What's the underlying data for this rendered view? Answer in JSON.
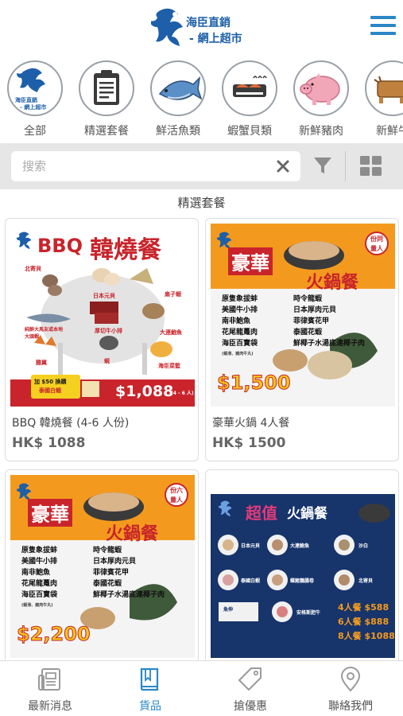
{
  "header": {
    "logo_line1": "海臣直銷",
    "logo_line2": "- 網上超市",
    "logo_mini1": "海臣直銷",
    "logo_mini2": "- 網上超市"
  },
  "categories": [
    {
      "label": "全部",
      "icon": "logo-icon"
    },
    {
      "label": "精選套餐",
      "icon": "clipboard-icon"
    },
    {
      "label": "鮮活魚類",
      "icon": "fish-icon"
    },
    {
      "label": "蝦蟹貝類",
      "icon": "shellfish-icon"
    },
    {
      "label": "新鮮豬肉",
      "icon": "pig-icon"
    },
    {
      "label": "新鮮牛",
      "icon": "cow-icon"
    }
  ],
  "search": {
    "placeholder": "搜索",
    "value": ""
  },
  "section_title": "精選套餐",
  "products": [
    {
      "name": "BBQ 韓燒餐 (4-6 人份)",
      "price": "HK$ 1088",
      "poster": {
        "title_en": "BBQ",
        "title_zh": "韓燒餐",
        "items": [
          "北寄貝",
          "日本元貝",
          "扇子蝦",
          "純鮮大馬友或本地大頭蝦",
          "厚切牛小排",
          "大連鮑魚",
          "雞翼",
          "蜆",
          "海臣菜籃"
        ],
        "promo_1": "加 $50 換購",
        "promo_2": "泰國白蝦",
        "price": "$1,088",
        "servings": "(4 - 6 人)"
      }
    },
    {
      "name": "豪華火鍋 4人餐",
      "price": "HK$ 1500",
      "poster": {
        "title_1": "豪華",
        "title_2": "火鍋餐",
        "badge_1": "份同",
        "badge_2": "量人",
        "items_left": [
          "原隻象拔蚌",
          "美國牛小排",
          "南非鮑魚",
          "花尾龍躉肉",
          "海臣百寶袋"
        ],
        "items_right": [
          "時令龍蝦",
          "日本厚肉元貝",
          "菲律賓花甲",
          "泰國花蝦",
          "鮮椰子水湯底連椰子肉"
        ],
        "note": "(蝦滑、豬肉牛丸)",
        "price": "$1,500"
      }
    },
    {
      "name": "豪華火鍋 6人餐",
      "price": "HK$ 2200",
      "poster": {
        "title_1": "豪華",
        "title_2": "火鍋餐",
        "badge_1": "份六",
        "badge_2": "量人",
        "items_left": [
          "原隻象拔蚌",
          "美國牛小排",
          "南非鮑魚",
          "花尾龍躉肉",
          "海臣百寶袋"
        ],
        "items_right": [
          "時令龍蝦",
          "日本厚肉元貝",
          "菲律賓花甲",
          "泰國花蝦",
          "鮮椰子水湯底連椰子肉"
        ],
        "note": "(蝦滑、豬肉牛丸)",
        "price": "$2,200"
      }
    },
    {
      "name": "超值火鍋餐",
      "price": "",
      "poster": {
        "title_1": "超值",
        "title_2": "火鍋餐",
        "items": [
          "日本元貝",
          "大連鮑魚",
          "沙白",
          "泰國白蝦",
          "蝶豬鵝腸卷",
          "北寄貝",
          "魚伸",
          "安格斯肥牛"
        ],
        "offer_1": "4人餐 $588",
        "offer_2": "6人餐 $888",
        "offer_3": "8人餐 $1088"
      }
    }
  ],
  "bottom_nav": [
    {
      "label": "最新消息",
      "icon": "news-icon"
    },
    {
      "label": "貨品",
      "icon": "book-icon",
      "active": true
    },
    {
      "label": "搶優惠",
      "icon": "tag-icon"
    },
    {
      "label": "聯絡我們",
      "icon": "location-pin-icon"
    }
  ],
  "colors": {
    "accent": "#2a87c7",
    "brand_blue": "#1d5fa8",
    "poster_red": "#c9242b",
    "poster_orange": "#f39a1e",
    "poster_navy": "#17346b"
  }
}
